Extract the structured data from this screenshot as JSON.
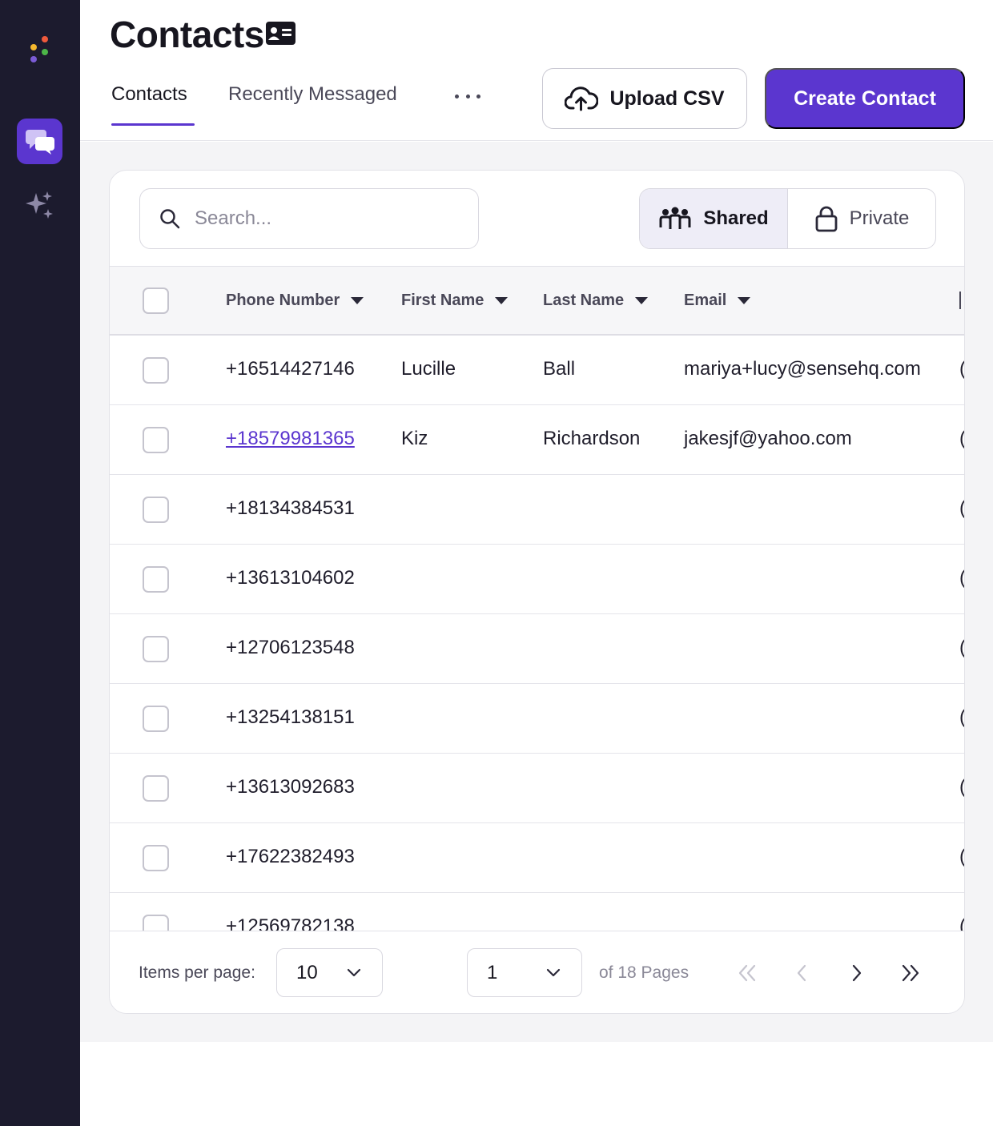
{
  "app": {
    "logo_colors": [
      "#ef5a3c",
      "#f5b82e",
      "#4cb648",
      "#7b5cd6"
    ],
    "accent_color": "#5b36cf",
    "sidebar": {
      "items": [
        {
          "icon": "chat-bubbles-icon",
          "active": true
        },
        {
          "icon": "sparkle-icon",
          "active": false
        }
      ]
    }
  },
  "header": {
    "title": "Contacts",
    "title_icon": "contact-card-icon",
    "tabs": [
      {
        "label": "Contacts",
        "active": true
      },
      {
        "label": "Recently Messaged",
        "active": false
      }
    ],
    "more_icon": "more-horizontal-icon",
    "upload_label": "Upload CSV",
    "create_label": "Create Contact"
  },
  "toolbar": {
    "search_placeholder": "Search...",
    "visibility": {
      "shared_label": "Shared",
      "private_label": "Private",
      "selected": "Shared"
    }
  },
  "table": {
    "columns": [
      "Phone Number",
      "First Name",
      "Last Name",
      "Email"
    ],
    "rows": [
      {
        "phone": "+16514427146",
        "first": "Lucille",
        "last": "Ball",
        "email": "mariya+lucy@sensehq.com"
      },
      {
        "phone": "+18579981365",
        "first": "Kiz",
        "last": "Richardson",
        "email": "jakesjf@yahoo.com"
      },
      {
        "phone": "+18134384531",
        "first": "",
        "last": "",
        "email": ""
      },
      {
        "phone": "+13613104602",
        "first": "",
        "last": "",
        "email": ""
      },
      {
        "phone": "+12706123548",
        "first": "",
        "last": "",
        "email": ""
      },
      {
        "phone": "+13254138151",
        "first": "",
        "last": "",
        "email": ""
      },
      {
        "phone": "+13613092683",
        "first": "",
        "last": "",
        "email": ""
      },
      {
        "phone": "+17622382493",
        "first": "",
        "last": "",
        "email": ""
      },
      {
        "phone": "+12569782138",
        "first": "",
        "last": "",
        "email": ""
      }
    ]
  },
  "pagination": {
    "items_per_page_label": "Items per page:",
    "items_per_page": "10",
    "current_page": "1",
    "pages_label": "of 18 Pages"
  }
}
